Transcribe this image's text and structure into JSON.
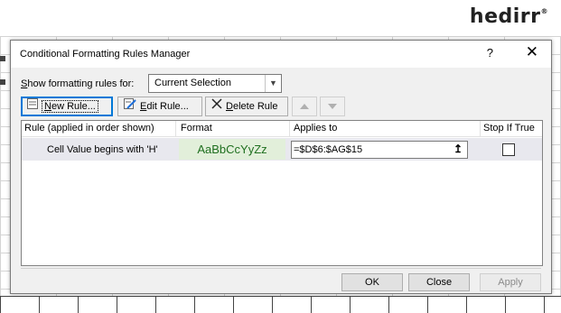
{
  "logo": {
    "text": "hedirr",
    "mark": "®"
  },
  "dialog": {
    "title": "Conditional Formatting Rules Manager",
    "help": "?",
    "close": "✕"
  },
  "scope": {
    "label_accel": "S",
    "label_rest": "how formatting rules for:",
    "value": "Current Selection"
  },
  "toolbar": {
    "new_accel": "N",
    "new_rest": "ew Rule...",
    "edit_accel": "E",
    "edit_rest": "dit Rule...",
    "delete_accel": "D",
    "delete_rest": "elete Rule"
  },
  "rules_table": {
    "headers": [
      "Rule (applied in order shown)",
      "Format",
      "Applies to",
      "Stop If True"
    ],
    "rows": [
      {
        "rule": "Cell Value begins with 'H'",
        "format_preview": "AaBbCcYyZz",
        "applies_to": "=$D$6:$AG$15",
        "stop_if_true": false
      }
    ]
  },
  "buttons": {
    "ok": "OK",
    "close": "Close",
    "apply": "Apply"
  },
  "colors": {
    "accent": "#0078d7",
    "format_bg": "#e2efda",
    "row_selected": "#e8e8ee"
  }
}
